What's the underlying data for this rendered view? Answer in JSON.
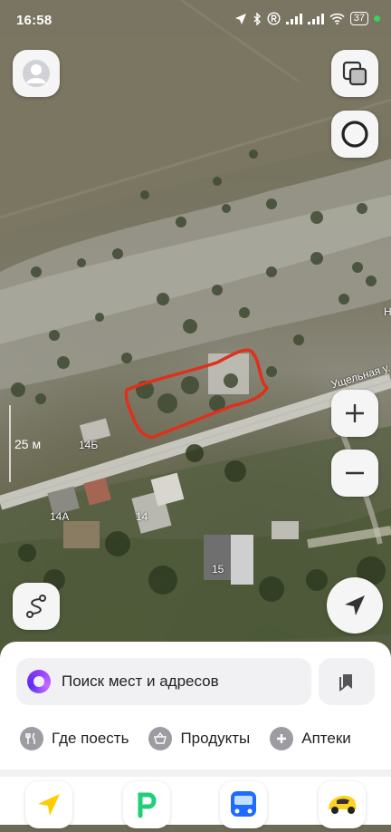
{
  "status_bar": {
    "time": "16:58",
    "battery": "37"
  },
  "map": {
    "scale_label": "25 м",
    "street_label": "Ущельная у.",
    "edge_label": "Н",
    "house_numbers": [
      "14Б",
      "14А",
      "14",
      "15"
    ]
  },
  "search": {
    "placeholder": "Поиск мест и адресов"
  },
  "categories": [
    {
      "label": "Где поесть",
      "icon": "fork-knife-icon"
    },
    {
      "label": "Продукты",
      "icon": "basket-icon"
    },
    {
      "label": "Аптеки",
      "icon": "plus-icon"
    }
  ],
  "apps": [
    {
      "name": "navigator",
      "icon": "navigator-arrow-icon",
      "color": "#ffcc00"
    },
    {
      "name": "parking",
      "icon": "parking-p-icon",
      "color": "#1fcf7a"
    },
    {
      "name": "transport",
      "icon": "bus-icon",
      "color": "#1e6cff"
    },
    {
      "name": "taxi",
      "icon": "taxi-car-icon",
      "color": "#ffd21f"
    }
  ],
  "colors": {
    "annotation": "#e0301c",
    "accent": "#8e3cf7"
  }
}
